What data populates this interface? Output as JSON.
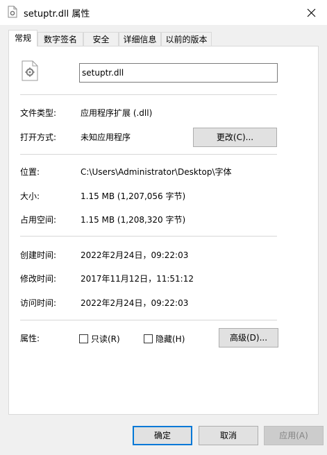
{
  "window": {
    "title": "setuptr.dll 属性"
  },
  "tabs": [
    {
      "label": "常规",
      "active": true
    },
    {
      "label": "数字签名"
    },
    {
      "label": "安全"
    },
    {
      "label": "详细信息"
    },
    {
      "label": "以前的版本"
    }
  ],
  "general": {
    "filename": "setuptr.dll",
    "file_type_label": "文件类型:",
    "file_type_value": "应用程序扩展 (.dll)",
    "opens_with_label": "打开方式:",
    "opens_with_value": "未知应用程序",
    "change_button": "更改(C)...",
    "location_label": "位置:",
    "location_value": "C:\\Users\\Administrator\\Desktop\\字体",
    "size_label": "大小:",
    "size_value": "1.15 MB (1,207,056 字节)",
    "size_on_disk_label": "占用空间:",
    "size_on_disk_value": "1.15 MB (1,208,320 字节)",
    "created_label": "创建时间:",
    "created_value": "2022年2月24日，09:22:03",
    "modified_label": "修改时间:",
    "modified_value": "2017年11月12日，11:51:12",
    "accessed_label": "访问时间:",
    "accessed_value": "2022年2月24日，09:22:03",
    "attributes_label": "属性:",
    "readonly_label": "只读(R)",
    "readonly_checked": false,
    "hidden_label": "隐藏(H)",
    "hidden_checked": false,
    "advanced_button": "高级(D)..."
  },
  "footer": {
    "ok": "确定",
    "cancel": "取消",
    "apply": "应用(A)"
  },
  "colors": {
    "default_button_border": "#0078d7",
    "disabled_text": "#838383"
  }
}
